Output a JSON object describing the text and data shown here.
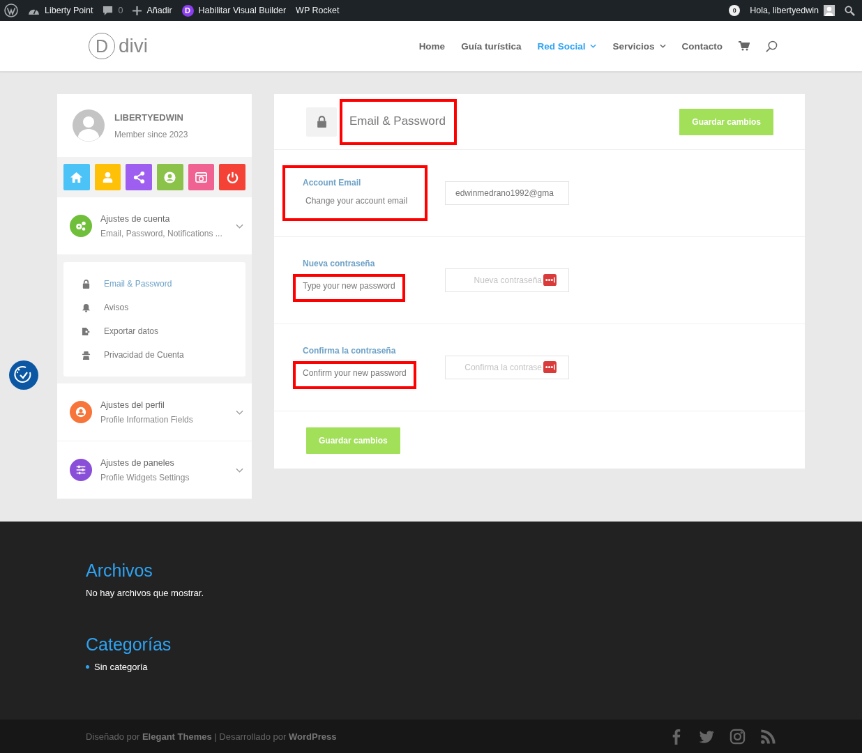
{
  "admin_bar": {
    "items": [
      {
        "kind": "wp"
      },
      {
        "kind": "site",
        "label": "Liberty Point"
      },
      {
        "kind": "comments",
        "label": "0"
      },
      {
        "kind": "new",
        "label": "Añadir"
      },
      {
        "kind": "divi",
        "letter": "D",
        "label": "Habilitar Visual Builder"
      },
      {
        "kind": "text",
        "label": "WP Rocket"
      }
    ],
    "counter": "0",
    "greeting": "Hola, libertyedwin"
  },
  "header": {
    "logo": {
      "letter": "D",
      "text": "divi"
    },
    "nav": [
      {
        "label": "Home",
        "selected": false,
        "dropdown": false
      },
      {
        "label": "Guía turística",
        "selected": false,
        "dropdown": false
      },
      {
        "label": "Red Social",
        "selected": true,
        "dropdown": true
      },
      {
        "label": "Servicios",
        "selected": false,
        "dropdown": true
      },
      {
        "label": "Contacto",
        "selected": false,
        "dropdown": false
      }
    ]
  },
  "sidebar": {
    "profile": {
      "name": "LIBERTYEDWIN",
      "since": "Member since 2023"
    },
    "quick_buttons": [
      {
        "kind": "home",
        "color": "#4cc3f7"
      },
      {
        "kind": "user",
        "color": "#ffc107"
      },
      {
        "kind": "share",
        "color": "#9e5ff0"
      },
      {
        "kind": "account",
        "color": "#8bc34a"
      },
      {
        "kind": "photo",
        "color": "#f06292"
      },
      {
        "kind": "power",
        "color": "#f44336"
      }
    ],
    "sections": [
      {
        "kind": "gears",
        "color": "#6fbf3a",
        "title": "Ajustes de cuenta",
        "subtitle": "Email, Password, Notifications ...",
        "children": [
          {
            "kind": "lock",
            "label": "Email & Password",
            "selected": true
          },
          {
            "kind": "bell",
            "label": "Avisos",
            "selected": false
          },
          {
            "kind": "export",
            "label": "Exportar datos",
            "selected": false
          },
          {
            "kind": "spy",
            "label": "Privacidad de Cuenta",
            "selected": false
          }
        ]
      },
      {
        "kind": "person",
        "color": "#f7743a",
        "title": "Ajustes del perfil",
        "subtitle": "Profile Information Fields"
      },
      {
        "kind": "sliders",
        "color": "#8a4fd8",
        "title": "Ajustes de paneles",
        "subtitle": "Profile Widgets Settings"
      }
    ]
  },
  "panel": {
    "title": "Email & Password",
    "title_highlighted": true,
    "save_top": "Guardar cambios",
    "fields": [
      {
        "kind": "email",
        "label": "Account Email",
        "hint": "Change your account email",
        "text_framed": true,
        "hint_framed": false,
        "value": "edwinmedrano1992@gma"
      },
      {
        "kind": "password",
        "label": "Nueva contraseña",
        "hint": "Type your new password",
        "text_framed": false,
        "hint_framed": true,
        "placeholder": "Nueva contraseña"
      },
      {
        "kind": "password",
        "label": "Confirma la contraseña",
        "hint": "Confirm your new password",
        "text_framed": false,
        "hint_framed": true,
        "placeholder": "Confirma la contrase"
      }
    ],
    "save_bottom": "Guardar cambios"
  },
  "footer": {
    "widgets": [
      {
        "title": "Archivos",
        "kind": "text",
        "text": "No hay archivos que mostrar."
      },
      {
        "title": "Categorías",
        "kind": "list",
        "items": [
          "Sin categoría"
        ]
      }
    ],
    "credit": "Diseñado por **Elegant Themes** | Desarrollado por **WordPress**",
    "social": [
      {
        "kind": "facebook"
      },
      {
        "kind": "twitter"
      },
      {
        "kind": "instagram"
      },
      {
        "kind": "rss"
      }
    ]
  }
}
